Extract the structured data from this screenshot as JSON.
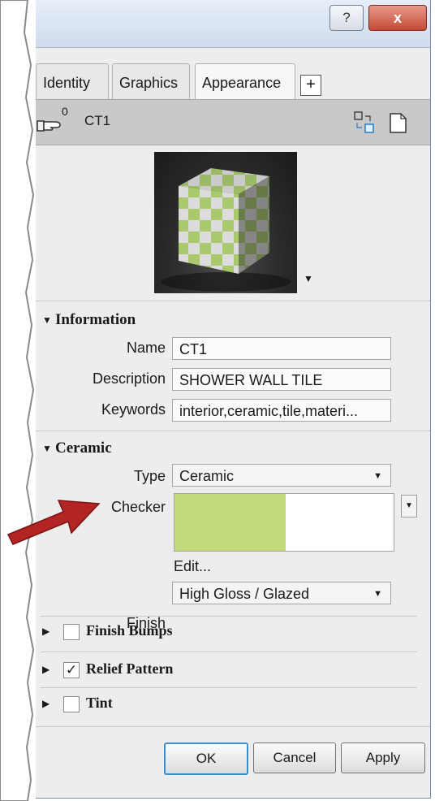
{
  "window": {
    "help_glyph": "?",
    "close_glyph": "x"
  },
  "tabs": [
    {
      "label": "Identity"
    },
    {
      "label": "Graphics"
    },
    {
      "label": "Appearance"
    }
  ],
  "tab_add_glyph": "+",
  "asset": {
    "user_count": "0",
    "name": "CT1"
  },
  "information": {
    "title": "Information",
    "name_label": "Name",
    "name_value": "CT1",
    "description_label": "Description",
    "description_value": "SHOWER WALL TILE",
    "keywords_label": "Keywords",
    "keywords_value": "interior,ceramic,tile,materi..."
  },
  "ceramic": {
    "title": "Ceramic",
    "type_label": "Type",
    "type_value": "Ceramic",
    "checker_label": "Checker",
    "checker_colors": [
      "#c2d97e",
      "#ffffff"
    ],
    "edit_label": "Edit...",
    "finish_label": "Finish",
    "finish_value": "High Gloss / Glazed"
  },
  "properties": [
    {
      "label": "Finish Bumps",
      "checked": false
    },
    {
      "label": "Relief Pattern",
      "checked": true
    },
    {
      "label": "Tint",
      "checked": false
    }
  ],
  "checkmark": "✓",
  "buttons": {
    "ok": "OK",
    "cancel": "Cancel",
    "apply": "Apply"
  },
  "accent_color": "#3a8fd0",
  "annotation_arrow_color": "#b32424"
}
